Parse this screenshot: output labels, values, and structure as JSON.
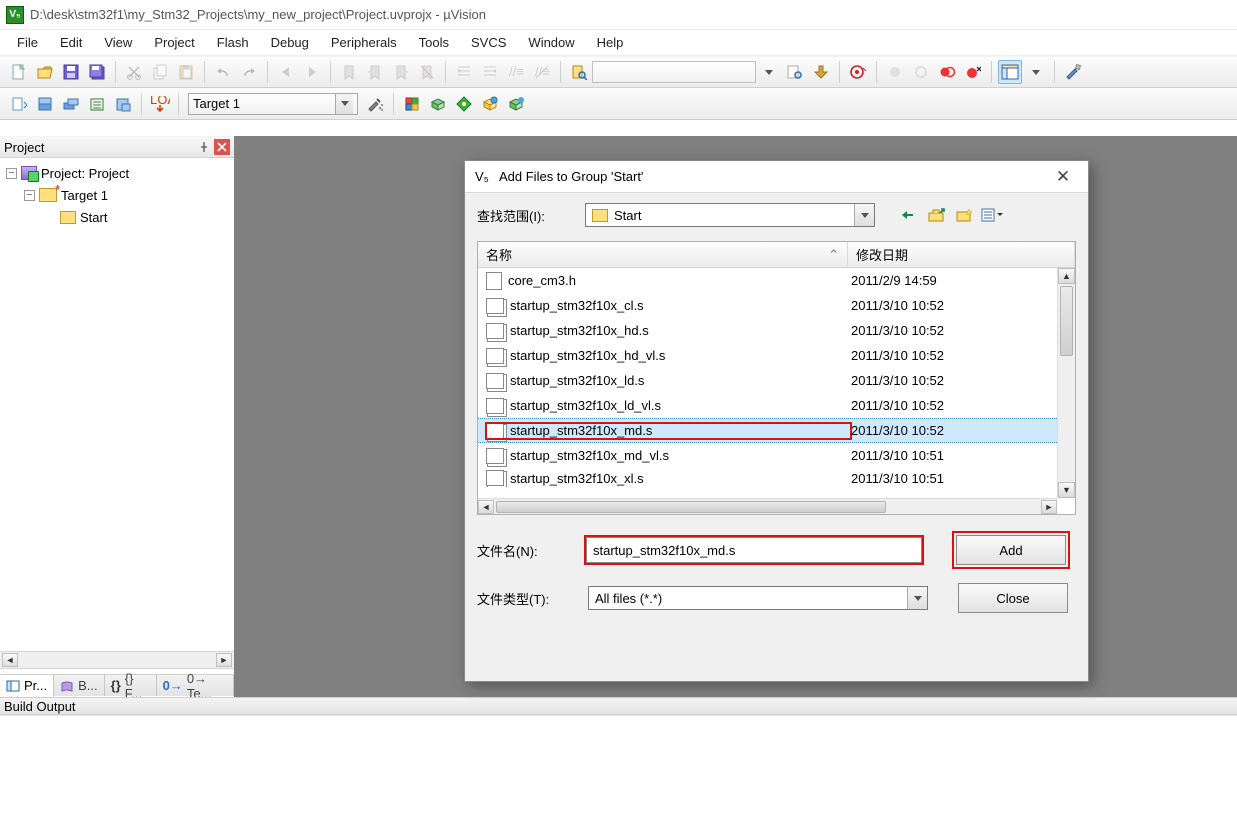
{
  "titlebar": {
    "path": "D:\\desk\\stm32f1\\my_Stm32_Projects\\my_new_project\\Project.uvprojx - µVision",
    "app_glyph": "V₅"
  },
  "menubar": [
    "File",
    "Edit",
    "View",
    "Project",
    "Flash",
    "Debug",
    "Peripherals",
    "Tools",
    "SVCS",
    "Window",
    "Help"
  ],
  "toolbar2": {
    "target_select": "Target 1"
  },
  "project_panel": {
    "title": "Project",
    "tree": {
      "root_label": "Project: Project",
      "target_label": "Target 1",
      "group_label": "Start"
    },
    "tabs": [
      "Pr...",
      "B...",
      "{} F...",
      "0→ Te..."
    ]
  },
  "build_output": {
    "title": "Build Output"
  },
  "dialog": {
    "title": "Add Files to Group 'Start'",
    "lookin_label": "查找范围(I):",
    "lookin_value": "Start",
    "cols": {
      "name": "名称",
      "date": "修改日期"
    },
    "files": [
      {
        "name": "core_cm3.h",
        "date": "2011/2/9 14:59",
        "icon": "h"
      },
      {
        "name": "startup_stm32f10x_cl.s",
        "date": "2011/3/10 10:52",
        "icon": "s"
      },
      {
        "name": "startup_stm32f10x_hd.s",
        "date": "2011/3/10 10:52",
        "icon": "s"
      },
      {
        "name": "startup_stm32f10x_hd_vl.s",
        "date": "2011/3/10 10:52",
        "icon": "s"
      },
      {
        "name": "startup_stm32f10x_ld.s",
        "date": "2011/3/10 10:52",
        "icon": "s"
      },
      {
        "name": "startup_stm32f10x_ld_vl.s",
        "date": "2011/3/10 10:52",
        "icon": "s"
      },
      {
        "name": "startup_stm32f10x_md.s",
        "date": "2011/3/10 10:52",
        "icon": "s",
        "selected": true
      },
      {
        "name": "startup_stm32f10x_md_vl.s",
        "date": "2011/3/10 10:51",
        "icon": "s"
      },
      {
        "name": "startup_stm32f10x_xl.s",
        "date": "2011/3/10 10:51",
        "icon": "s",
        "cut": true
      }
    ],
    "filename_label": "文件名(N):",
    "filename_value": "startup_stm32f10x_md.s",
    "filetype_label": "文件类型(T):",
    "filetype_value": "All files (*.*)",
    "btn_add": "Add",
    "btn_close": "Close"
  }
}
